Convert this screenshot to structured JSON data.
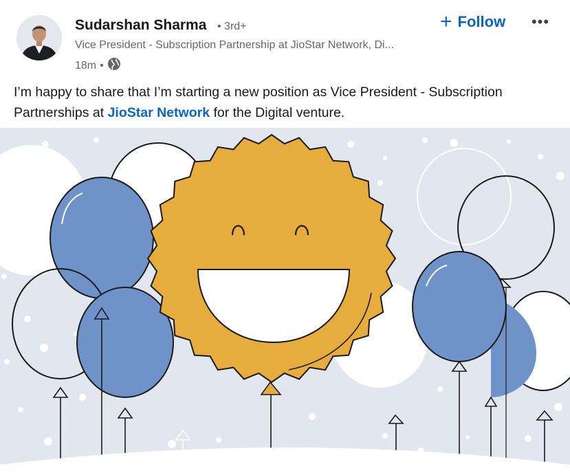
{
  "post": {
    "author": {
      "name": "Sudarshan Sharma",
      "degree": "• 3rd+",
      "headline": "Vice President - Subscription Partnership at JioStar Network, Di...",
      "time": "18m",
      "visibility_icon": "globe-icon"
    },
    "actions": {
      "follow_plus": "+",
      "follow_label": "Follow",
      "more_icon": "more-horizontal-icon",
      "more_label": "•••"
    },
    "text": {
      "part1": "I’m happy to share that I’m starting a new position as Vice President - Subscription Partnerships at ",
      "mention": "JioStar Network",
      "part2": " for the Digital venture."
    },
    "image": {
      "background": "#e2e6ee",
      "sun_color": "#e6ac3e",
      "balloon_blue": "#6f93c9"
    }
  },
  "colors": {
    "link": "#0a66c2",
    "secondary_text": "#666666"
  }
}
